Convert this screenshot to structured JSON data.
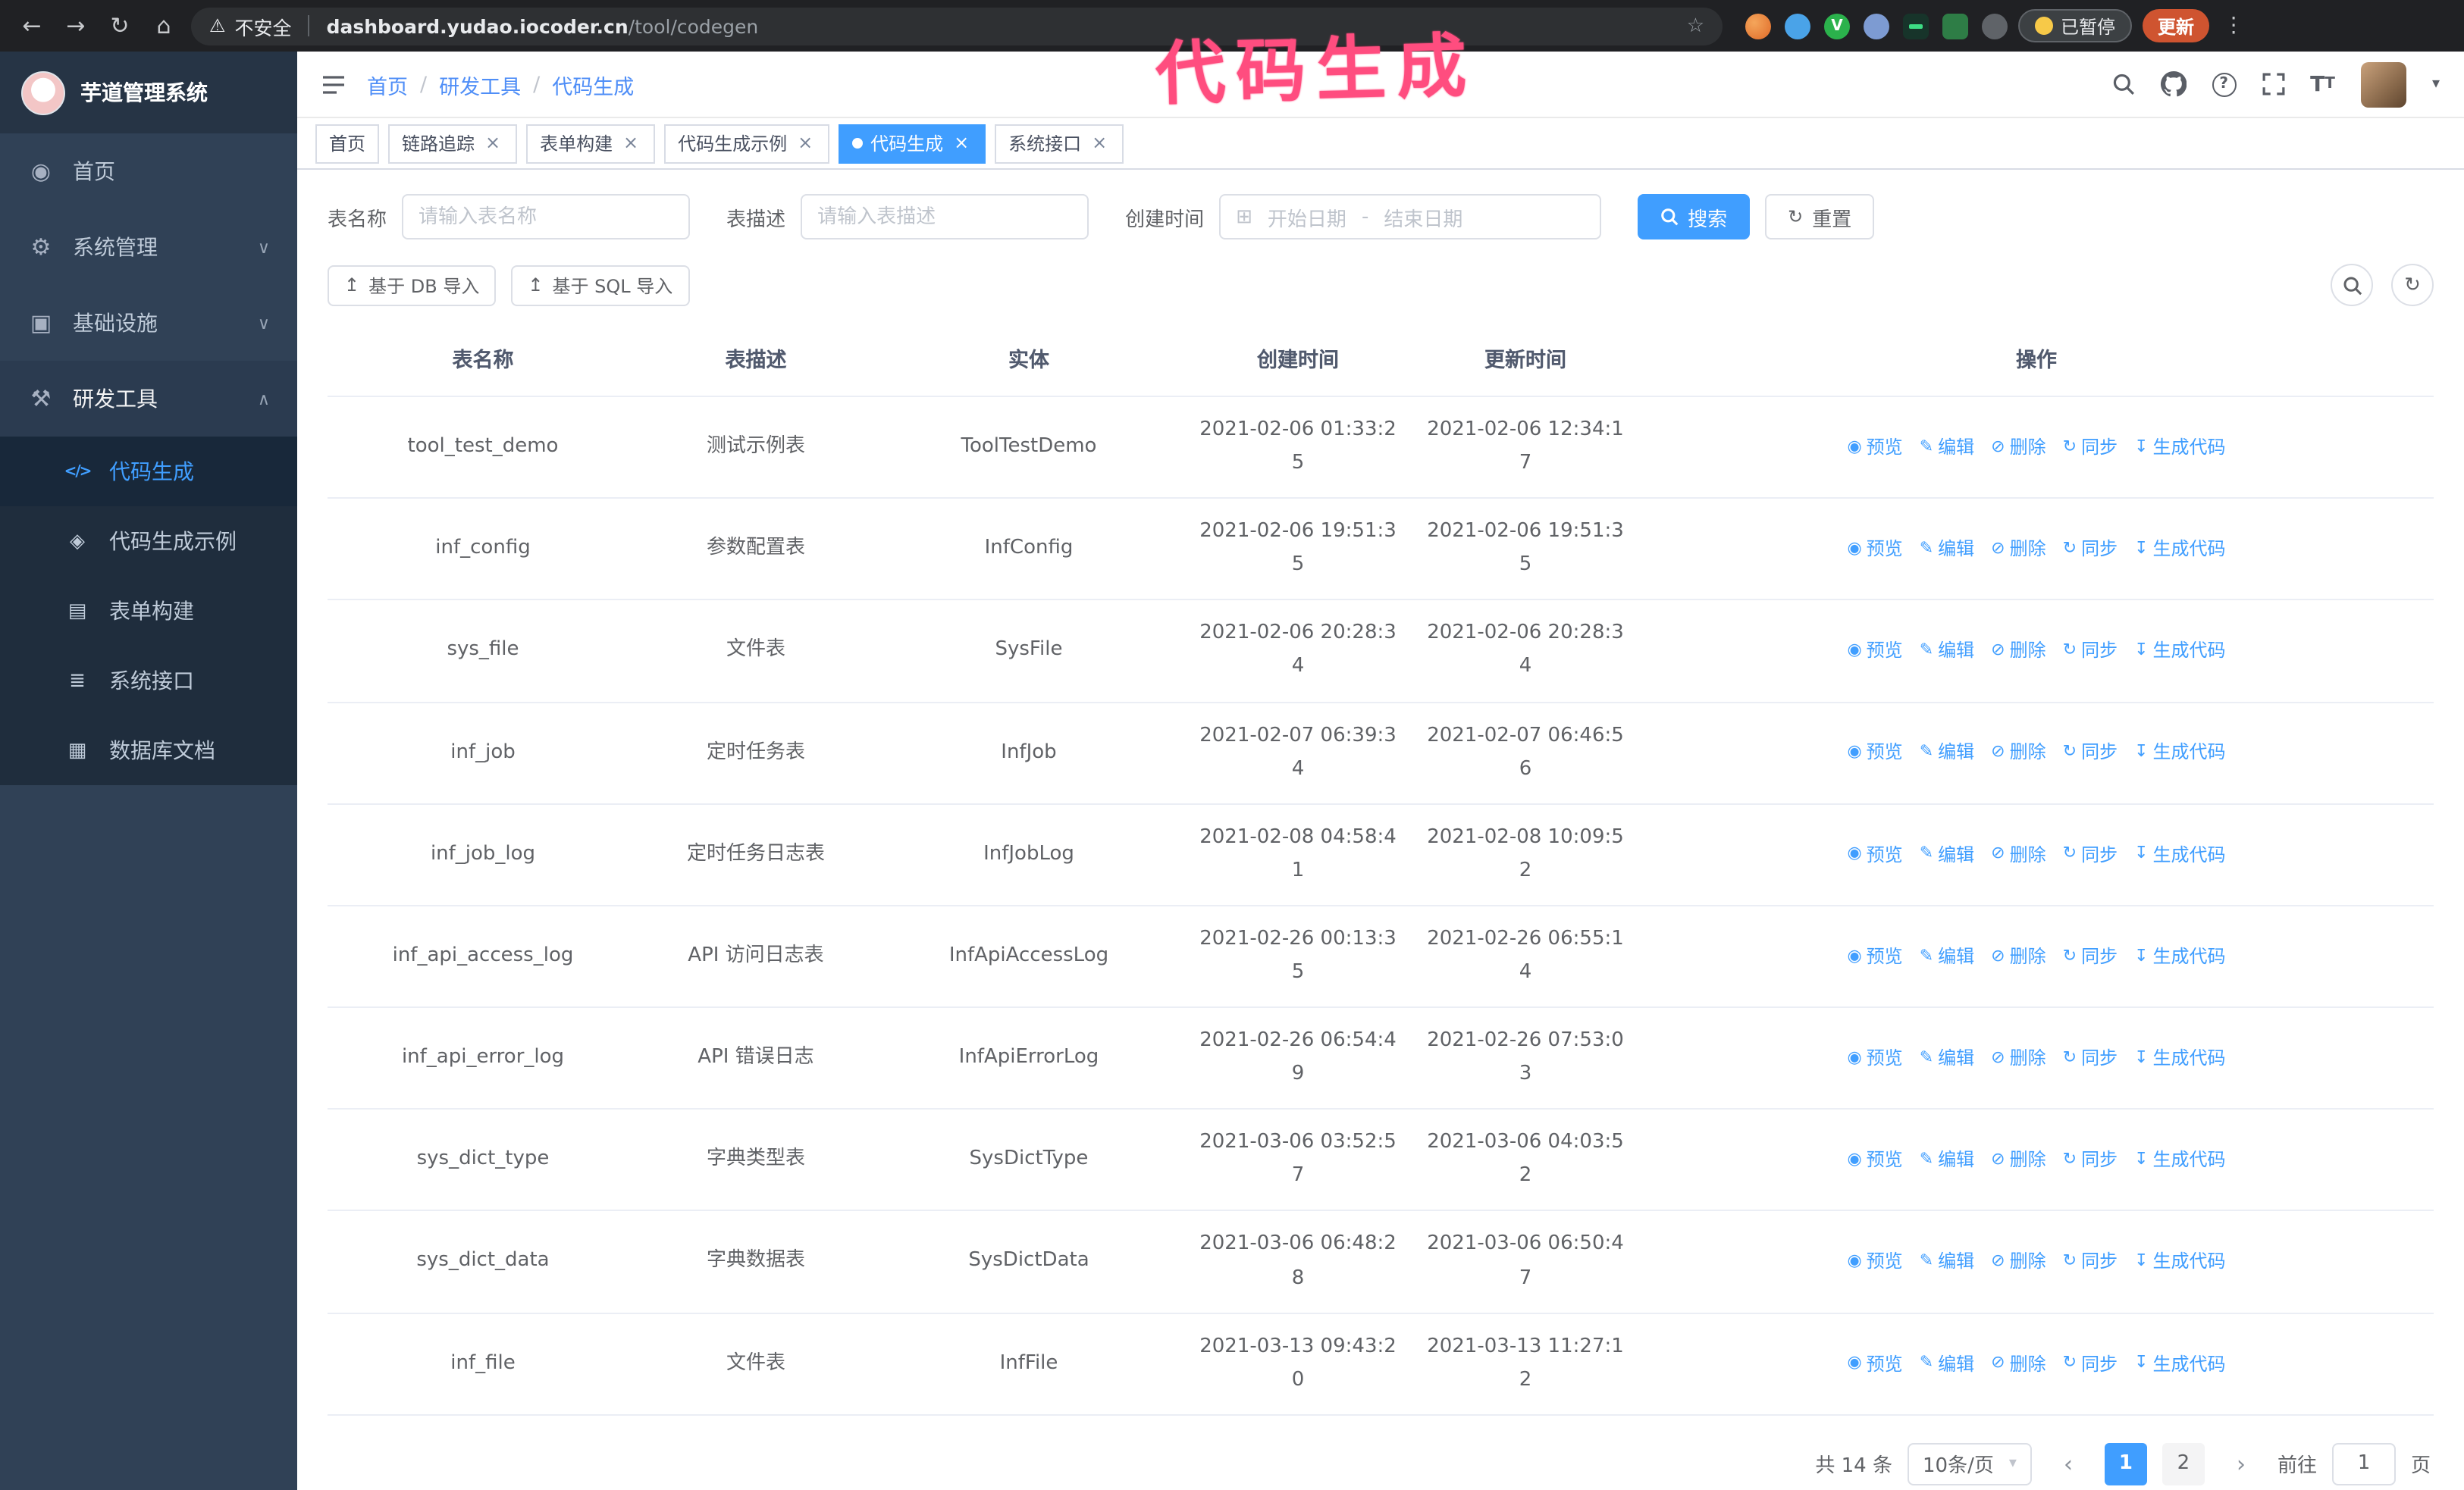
{
  "browser": {
    "security_label": "不安全",
    "url_domain": "dashboard.yudao.iocoder.cn",
    "url_path": "/tool/codegen",
    "paused_badge": "已暂停",
    "update_button": "更新",
    "green_ext_letter": "V"
  },
  "annotation": {
    "text": "代码生成",
    "color": "#ff4d7f"
  },
  "app": {
    "title": "芋道管理系统"
  },
  "icons": {
    "back": "←",
    "forward": "→",
    "reload": "↻",
    "home": "⌂",
    "warning": "⚠",
    "star": "☆",
    "kebab": "⋮",
    "dashboard": "◉",
    "gear": "⚙",
    "infra": "▣",
    "tools": "⚒",
    "chevron_down": "∨",
    "chevron_up": "∧",
    "code": "</>",
    "example": "◈",
    "form": "▤",
    "api": "≣",
    "dbdoc": "▦",
    "calendar": "⊞",
    "refresh": "↻",
    "import": "↥",
    "caret_down": "▾",
    "prev": "‹",
    "next": "›",
    "close": "×",
    "help": "?"
  },
  "sidebar": {
    "items": [
      {
        "label": "首页"
      },
      {
        "label": "系统管理"
      },
      {
        "label": "基础设施"
      },
      {
        "label": "研发工具"
      }
    ],
    "children": [
      {
        "label": "代码生成",
        "active": true
      },
      {
        "label": "代码生成示例"
      },
      {
        "label": "表单构建"
      },
      {
        "label": "系统接口"
      },
      {
        "label": "数据库文档"
      }
    ]
  },
  "breadcrumb": {
    "items": [
      "首页",
      "研发工具",
      "代码生成"
    ]
  },
  "tabs": [
    {
      "label": "首页",
      "closable": false,
      "active": false
    },
    {
      "label": "链路追踪",
      "closable": true,
      "active": false
    },
    {
      "label": "表单构建",
      "closable": true,
      "active": false
    },
    {
      "label": "代码生成示例",
      "closable": true,
      "active": false
    },
    {
      "label": "代码生成",
      "closable": true,
      "active": true
    },
    {
      "label": "系统接口",
      "closable": true,
      "active": false
    }
  ],
  "filters": {
    "name_label": "表名称",
    "name_placeholder": "请输入表名称",
    "desc_label": "表描述",
    "desc_placeholder": "请输入表描述",
    "time_label": "创建时间",
    "start_placeholder": "开始日期",
    "range_separator": "-",
    "end_placeholder": "结束日期",
    "search_label": "搜索",
    "reset_label": "重置"
  },
  "toolbar": {
    "import_db_label": "基于 DB 导入",
    "import_sql_label": "基于 SQL 导入"
  },
  "table": {
    "columns": [
      "表名称",
      "表描述",
      "实体",
      "创建时间",
      "更新时间",
      "操作"
    ],
    "rows": [
      {
        "name": "tool_test_demo",
        "desc": "测试示例表",
        "entity": "ToolTestDemo",
        "created": "2021-02-06 01:33:25",
        "updated": "2021-02-06 12:34:17"
      },
      {
        "name": "inf_config",
        "desc": "参数配置表",
        "entity": "InfConfig",
        "created": "2021-02-06 19:51:35",
        "updated": "2021-02-06 19:51:35"
      },
      {
        "name": "sys_file",
        "desc": "文件表",
        "entity": "SysFile",
        "created": "2021-02-06 20:28:34",
        "updated": "2021-02-06 20:28:34"
      },
      {
        "name": "inf_job",
        "desc": "定时任务表",
        "entity": "InfJob",
        "created": "2021-02-07 06:39:34",
        "updated": "2021-02-07 06:46:56"
      },
      {
        "name": "inf_job_log",
        "desc": "定时任务日志表",
        "entity": "InfJobLog",
        "created": "2021-02-08 04:58:41",
        "updated": "2021-02-08 10:09:52"
      },
      {
        "name": "inf_api_access_log",
        "desc": "API 访问日志表",
        "entity": "InfApiAccessLog",
        "created": "2021-02-26 00:13:35",
        "updated": "2021-02-26 06:55:14"
      },
      {
        "name": "inf_api_error_log",
        "desc": "API 错误日志",
        "entity": "InfApiErrorLog",
        "created": "2021-02-26 06:54:49",
        "updated": "2021-02-26 07:53:03"
      },
      {
        "name": "sys_dict_type",
        "desc": "字典类型表",
        "entity": "SysDictType",
        "created": "2021-03-06 03:52:57",
        "updated": "2021-03-06 04:03:52"
      },
      {
        "name": "sys_dict_data",
        "desc": "字典数据表",
        "entity": "SysDictData",
        "created": "2021-03-06 06:48:28",
        "updated": "2021-03-06 06:50:47"
      },
      {
        "name": "inf_file",
        "desc": "文件表",
        "entity": "InfFile",
        "created": "2021-03-13 09:43:20",
        "updated": "2021-03-13 11:27:12"
      }
    ],
    "ops": [
      {
        "name": "preview-link",
        "icon": "eye-icon",
        "glyph": "◉",
        "label": "预览"
      },
      {
        "name": "edit-link",
        "icon": "edit-icon",
        "glyph": "✎",
        "label": "编辑"
      },
      {
        "name": "delete-link",
        "icon": "trash-icon",
        "glyph": "⊘",
        "label": "删除"
      },
      {
        "name": "sync-link",
        "icon": "sync-icon",
        "glyph": "↻",
        "label": "同步"
      },
      {
        "name": "generate-code-link",
        "icon": "download-icon",
        "glyph": "↧",
        "label": "生成代码"
      }
    ]
  },
  "pagination": {
    "total": "共 14 条",
    "page_size": "10条/页",
    "pages": [
      "1",
      "2"
    ],
    "active_page": "1",
    "goto_label": "前往",
    "goto_value": "1",
    "goto_unit": "页"
  },
  "colors": {
    "primary": "#409eff",
    "sidebar_bg": "#304156",
    "submenu_bg": "#1f2d3d"
  }
}
